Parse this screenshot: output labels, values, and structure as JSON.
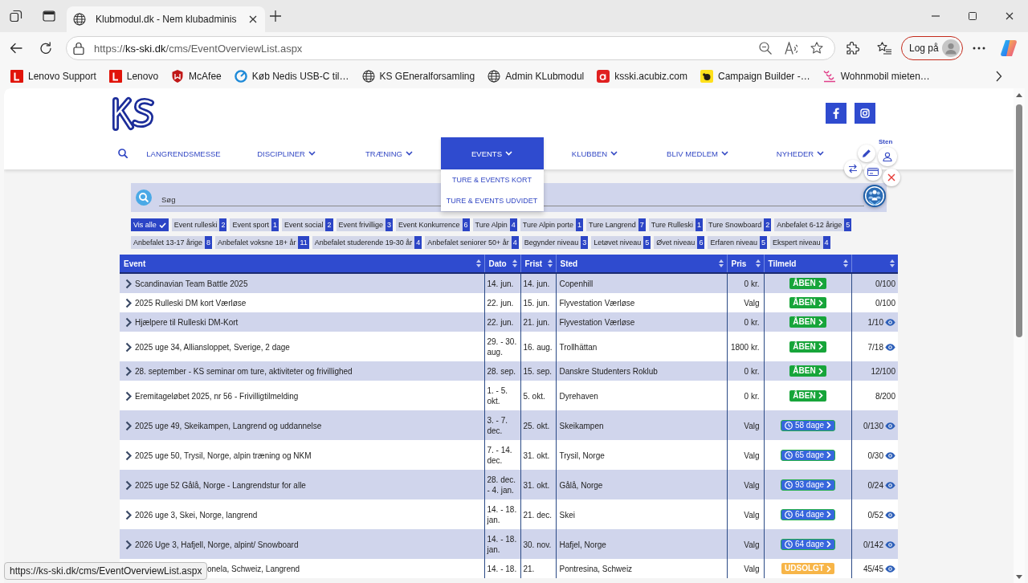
{
  "browser": {
    "tabs": [
      {
        "title": "Klubmodul.dk - Nem klubadminis",
        "selected": true
      }
    ],
    "address": "https://**ks-ski.dk**/cms/EventOverviewList.aspx",
    "account_button": "Log på",
    "bookmarks": [
      {
        "label": "Lenovo Support",
        "kind": "lenovo"
      },
      {
        "label": "Lenovo",
        "kind": "lenovo"
      },
      {
        "label": "McAfee",
        "kind": "mcafee"
      },
      {
        "label": "Køb Nedis USB-C til…",
        "kind": "nedis"
      },
      {
        "label": "KS GEneralforsamling",
        "kind": "globe"
      },
      {
        "label": "Admin KLubmodul",
        "kind": "globe"
      },
      {
        "label": "ksski.acubiz.com",
        "kind": "acubiz"
      },
      {
        "label": "Campaign Builder -…",
        "kind": "mailchimp"
      },
      {
        "label": "Wohnmobil mieten…",
        "kind": "wohnmobil"
      }
    ]
  },
  "header": {
    "nav": [
      {
        "label": "LANGRENDSMESSE",
        "has_menu": false,
        "selected": false,
        "expanded": false
      },
      {
        "label": "DISCIPLINER",
        "has_menu": true,
        "selected": false,
        "expanded": false
      },
      {
        "label": "TRÆNING",
        "has_menu": true,
        "selected": false,
        "expanded": false
      },
      {
        "label": "EVENTS",
        "has_menu": true,
        "selected": true,
        "expanded": true,
        "menu": [
          "TURE & EVENTS KORT",
          "TURE & EVENTS UDVIDET"
        ]
      },
      {
        "label": "KLUBBEN",
        "has_menu": true,
        "selected": false,
        "expanded": false
      },
      {
        "label": "BLIV MEDLEM",
        "has_menu": true,
        "selected": false,
        "expanded": false
      },
      {
        "label": "NYHEDER",
        "has_menu": true,
        "selected": false,
        "expanded": false
      }
    ]
  },
  "user_widget": {
    "name": "Sten"
  },
  "search": {
    "placeholder": "Søg"
  },
  "filters": [
    {
      "label": "Vis alle",
      "selected": true
    },
    {
      "label": "Event rulleski",
      "count": "2",
      "selected": false
    },
    {
      "label": "Event sport",
      "count": "1",
      "selected": false
    },
    {
      "label": "Event social",
      "count": "2",
      "selected": false
    },
    {
      "label": "Event frivillige",
      "count": "3",
      "selected": false
    },
    {
      "label": "Event Konkurrence",
      "count": "6",
      "selected": false
    },
    {
      "label": "Ture Alpin",
      "count": "4",
      "selected": false
    },
    {
      "label": "Ture Alpin porte",
      "count": "1",
      "selected": false
    },
    {
      "label": "Ture Langrend",
      "count": "7",
      "selected": false
    },
    {
      "label": "Ture Rulleski",
      "count": "1",
      "selected": false
    },
    {
      "label": "Ture Snowboard",
      "count": "2",
      "selected": false
    },
    {
      "label": "Anbefalet 6-12 årige",
      "count": "5",
      "selected": false
    },
    {
      "label": "Anbefalet 13-17 årige",
      "count": "8",
      "selected": false
    },
    {
      "label": "Anbefalet voksne 18+ år",
      "count": "11",
      "selected": false
    },
    {
      "label": "Anbefalet studerende 19-30 år",
      "count": "4",
      "selected": false
    },
    {
      "label": "Anbefalet seniorer 50+ år",
      "count": "4",
      "selected": false
    },
    {
      "label": "Begynder niveau",
      "count": "3",
      "selected": false
    },
    {
      "label": "Letøvet niveau",
      "count": "5",
      "selected": false
    },
    {
      "label": "Øvet niveau",
      "count": "6",
      "selected": false
    },
    {
      "label": "Erfaren niveau",
      "count": "5",
      "selected": false
    },
    {
      "label": "Ekspert niveau",
      "count": "4",
      "selected": false
    }
  ],
  "table": {
    "columns": [
      {
        "label": "Event",
        "sortable": true
      },
      {
        "label": "Dato",
        "sortable": true
      },
      {
        "label": "Frist",
        "sortable": true
      },
      {
        "label": "Sted",
        "sortable": true
      },
      {
        "label": "Pris",
        "sortable": true
      },
      {
        "label": "Tilmeld",
        "sortable": true
      },
      {
        "sortable": true
      }
    ],
    "rows": [
      {
        "covered": false,
        "event": "Scandinavian Team Battle 2025",
        "date": "14. jun.",
        "deadline": "14. jun.",
        "venue": "Copenhill",
        "price": "0 kr.",
        "signup": {
          "kind": "open",
          "label": "ÅBEN"
        },
        "column_7": "0/100",
        "column_7_icon": false
      },
      {
        "covered": false,
        "event": "2025 Rulleski DM kort Værløse",
        "date": "22. jun.",
        "deadline": "15. jun.",
        "venue": "Flyvestation Værløse",
        "price": "Valg",
        "signup": {
          "kind": "open",
          "label": "ÅBEN"
        },
        "column_7": "0/100",
        "column_7_icon": false
      },
      {
        "covered": false,
        "event": "Hjælpere til Rulleski DM-Kort",
        "date": "22. jun.",
        "deadline": "21. jun.",
        "venue": "Flyvestation Værløse",
        "price": "0 kr.",
        "signup": {
          "kind": "open",
          "label": "ÅBEN"
        },
        "column_7": "1/10",
        "column_7_icon": true
      },
      {
        "covered": false,
        "event": "2025 uge 34, Alliansloppet, Sverige, 2 dage",
        "date": "29. - 30. aug.",
        "deadline": "16. aug.",
        "venue": "Trollhättan",
        "price": "1800 kr.",
        "signup": {
          "kind": "open",
          "label": "ÅBEN"
        },
        "column_7": "7/18",
        "column_7_icon": true
      },
      {
        "covered": false,
        "event": "28. september - KS seminar om ture, aktiviteter og frivillighed",
        "date": "28. sep.",
        "deadline": "15. sep.",
        "venue": "Danskre Studenters Roklub",
        "price": "0 kr.",
        "signup": {
          "kind": "open",
          "label": "ÅBEN"
        },
        "column_7": "12/100",
        "column_7_icon": false
      },
      {
        "covered": false,
        "event": "Eremitageløbet 2025, nr 56 - Frivilligtilmelding",
        "date": "1. - 5. okt.",
        "deadline": "5. okt.",
        "venue": "Dyrehaven",
        "price": "0 kr.",
        "signup": {
          "kind": "open",
          "label": "ÅBEN"
        },
        "column_7": "8/200",
        "column_7_icon": false
      },
      {
        "covered": false,
        "event": "2025 uge 49, Skeikampen, Langrend og uddannelse",
        "date": "3. - 7. dec.",
        "deadline": "25. okt.",
        "venue": "Skeikampen",
        "price": "Valg",
        "signup": {
          "kind": "countdown",
          "label": "58 dage"
        },
        "column_7": "0/130",
        "column_7_icon": true
      },
      {
        "covered": false,
        "event": "2025 uge 50, Trysil, Norge, alpin træning og NKM",
        "date": "7. - 14. dec.",
        "deadline": "31. okt.",
        "venue": "Trysil, Norge",
        "price": "Valg",
        "signup": {
          "kind": "countdown",
          "label": "65 dage"
        },
        "column_7": "0/30",
        "column_7_icon": true
      },
      {
        "covered": false,
        "event": "2025 uge 52 Gålå, Norge - Langrendstur for alle",
        "date": "28. dec. - 4. jan.",
        "deadline": "31. okt.",
        "venue": "Gålå, Norge",
        "price": "Valg",
        "signup": {
          "kind": "countdown",
          "label": "93 dage"
        },
        "column_7": "0/24",
        "column_7_icon": true
      },
      {
        "covered": false,
        "event": "2026 uge 3, Skei, Norge, langrend",
        "date": "14. - 18. jan.",
        "deadline": "21. dec.",
        "venue": "Skei",
        "price": "Valg",
        "signup": {
          "kind": "countdown",
          "label": "64 dage"
        },
        "column_7": "0/52",
        "column_7_icon": true
      },
      {
        "covered": false,
        "event": "2026 Uge 3, Hafjell, Norge, alpint/ Snowboard",
        "date": "14. - 18. jan.",
        "deadline": "30. nov.",
        "venue": "Hafjel, Norge",
        "price": "Valg",
        "signup": {
          "kind": "countdown",
          "label": "64 dage"
        },
        "column_7": "0/142",
        "column_7_icon": true
      },
      {
        "covered": true,
        "event": "onela, Schweiz, Langrend",
        "date": "14. - 18.",
        "deadline": "21.",
        "venue": "Pontresina, Schweiz",
        "price": "Valg",
        "signup": {
          "kind": "soldout",
          "label": "UDSOLGT"
        },
        "column_7": "45/45",
        "column_7_icon": true
      }
    ]
  },
  "status_bar": {
    "url": "https://ks-ski.dk/cms/EventOverviewList.aspx"
  }
}
